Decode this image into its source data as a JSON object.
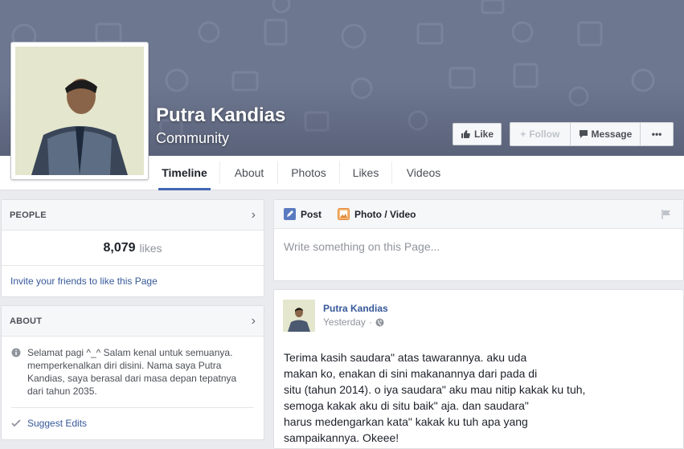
{
  "header": {
    "page_name": "Putra Kandias",
    "category": "Community",
    "buttons": {
      "like": "Like",
      "follow": "Follow",
      "message": "Message",
      "more": "•••"
    }
  },
  "tabs": [
    {
      "label": "Timeline",
      "active": true
    },
    {
      "label": "About",
      "active": false
    },
    {
      "label": "Photos",
      "active": false
    },
    {
      "label": "Likes",
      "active": false
    },
    {
      "label": "Videos",
      "active": false
    }
  ],
  "people": {
    "title": "PEOPLE",
    "likes_count": "8,079",
    "likes_label": "likes",
    "invite": "Invite your friends to like this Page"
  },
  "about": {
    "title": "ABOUT",
    "text": "Selamat pagi ^_^ Salam kenal untuk semuanya. memperkenalkan diri disini. Nama saya Putra Kandias, saya berasal dari masa depan tepatnya dari tahun 2035.",
    "suggest_edits": "Suggest Edits"
  },
  "composer": {
    "post_tab": "Post",
    "photo_tab": "Photo / Video",
    "placeholder": "Write something on this Page..."
  },
  "post": {
    "author": "Putra Kandias",
    "time": "Yesterday",
    "lines": [
      "Terima kasih saudara\" atas tawarannya. aku uda",
      "makan ko, enakan di sini makanannya dari pada di",
      "situ (tahun 2014). o iya saudara\" aku mau nitip kakak ku tuh,",
      "semoga kakak aku di situ baik\" aja. dan saudara\"",
      "harus medengarkan kata\" kakak ku tuh apa yang",
      "sampaikannya. Okeee!"
    ]
  },
  "colors": {
    "accent": "#4267b2",
    "link": "#365899",
    "cover": "#6d7790"
  }
}
